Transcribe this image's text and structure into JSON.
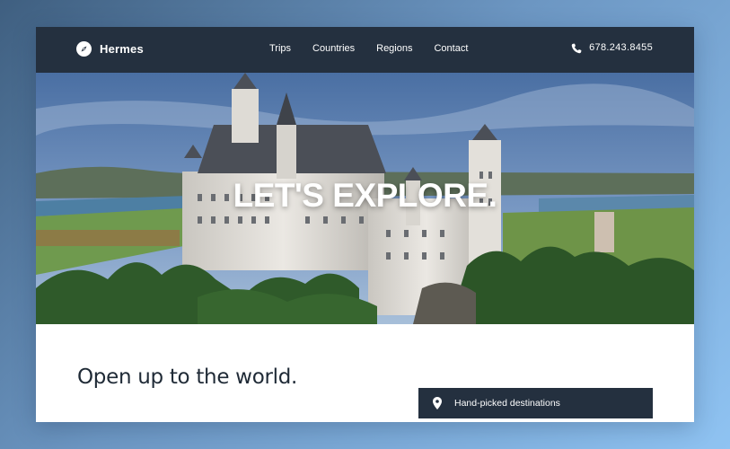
{
  "brand": {
    "name": "Hermes",
    "icon": "compass-icon"
  },
  "nav": {
    "items": [
      {
        "label": "Trips"
      },
      {
        "label": "Countries"
      },
      {
        "label": "Regions"
      },
      {
        "label": "Contact"
      }
    ]
  },
  "contact": {
    "phone": "678.243.8455",
    "icon": "phone-icon"
  },
  "hero": {
    "title": "LET'S EXPLORE."
  },
  "section": {
    "headline": "Open up to the world."
  },
  "feature": {
    "label": "Hand-picked destinations",
    "icon": "map-pin-icon"
  },
  "colors": {
    "nav_background": "#24303f",
    "feature_background": "#24303f",
    "headline_text": "#1f2a36",
    "page_background_start": "#3f5f80",
    "page_background_end": "#8fc3f2"
  }
}
